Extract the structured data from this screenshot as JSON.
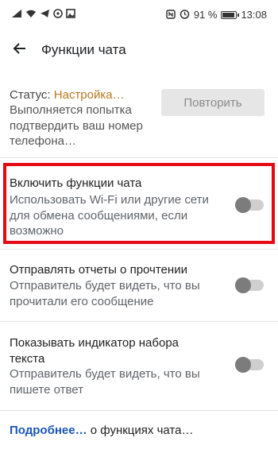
{
  "status_bar": {
    "left_icons": [
      "signal-icon",
      "wifi-icon",
      "telegram-icon",
      "viber-icon",
      "image-icon"
    ],
    "nfc_icon": "nfc-icon",
    "alarm_icon": "alarm-icon",
    "battery_percent": "91 %",
    "battery_level": 0.91,
    "time": "13:08"
  },
  "app_bar": {
    "back_icon": "arrow-back-icon",
    "title": "Функции чата"
  },
  "status_section": {
    "label": "Статус:",
    "value": "Настройка…",
    "description": "Выполняется попытка подтвердить ваш номер телефона…",
    "retry_label": "Повторить"
  },
  "settings": [
    {
      "title": "Включить функции чата",
      "description": "Использовать Wi-Fi или другие сети для обмена сообщениями, если возможно",
      "enabled": false
    },
    {
      "title": "Отправлять отчеты о прочтении",
      "description": "Отправитель будет видеть, что вы прочитали его сообщение",
      "enabled": false
    },
    {
      "title": "Показывать индикатор набора текста",
      "description": "Отправитель будет видеть, что вы пишете ответ",
      "enabled": false
    }
  ],
  "footer": {
    "link_text": "Подробнее…",
    "rest_text": " о функциях чата…"
  },
  "colors": {
    "highlight_border": "#e50914",
    "status_value": "#b7791f",
    "link": "#1a56b8"
  }
}
